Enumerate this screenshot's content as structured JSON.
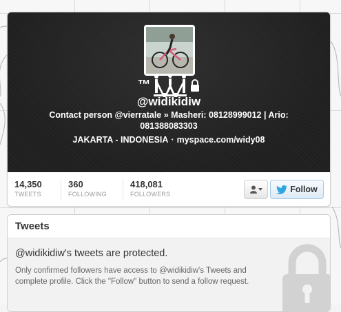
{
  "profile": {
    "tm": "™",
    "handle": "@widikidiw",
    "bio": "Contact person @vierratale » Masheri: 08128999012 | Ario: 081388083303",
    "location": "JAKARTA - INDONESIA",
    "separator": "·",
    "website": "myspace.com/widy08"
  },
  "stats": [
    {
      "value": "14,350",
      "label": "TWEETS"
    },
    {
      "value": "360",
      "label": "FOLLOWING"
    },
    {
      "value": "418,081",
      "label": "FOLLOWERS"
    }
  ],
  "actions": {
    "user_menu_icon": "user-dropdown-icon",
    "follow_label": "Follow",
    "follow_icon": "twitter-bird-icon"
  },
  "tweets": {
    "heading": "Tweets",
    "protected_title": "@widikidiw's tweets are protected.",
    "protected_body": "Only confirmed followers have access to @widikidiw's Tweets and complete profile. Click the \"Follow\" button to send a follow request."
  },
  "colors": {
    "header_bg": "#1e1e1e",
    "follow_blue": "#2fa6e0",
    "muted": "#999999"
  }
}
